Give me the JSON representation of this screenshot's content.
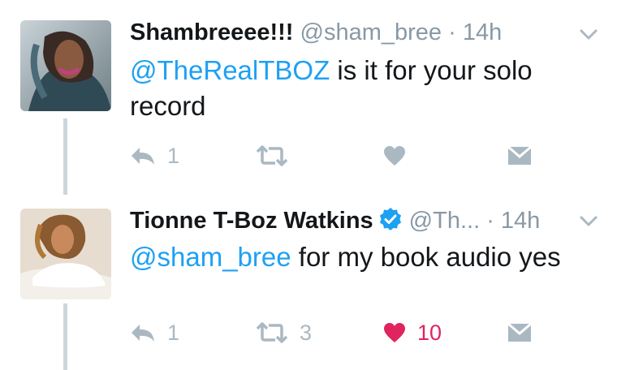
{
  "tweets": [
    {
      "name": "Shambreeee!!!",
      "verified": false,
      "handle": "@sham_bree",
      "separator": "·",
      "time": "14h",
      "mention": "@TheRealTBOZ",
      "text": " is it for your solo record",
      "reply_count": "1",
      "retweet_count": "",
      "like_count": "",
      "liked": false
    },
    {
      "name": "Tionne T-Boz Watkins",
      "verified": true,
      "handle": "@Th...",
      "separator": "·",
      "time": "14h",
      "mention": "@sham_bree",
      "text": " for my book audio yes",
      "reply_count": "1",
      "retweet_count": "3",
      "like_count": "10",
      "liked": true
    }
  ],
  "colors": {
    "link": "#1da1f2",
    "muted": "#8899a6",
    "icon": "#aab8c2",
    "like_active": "#e0245e",
    "verified_badge": "#1da1f2"
  }
}
